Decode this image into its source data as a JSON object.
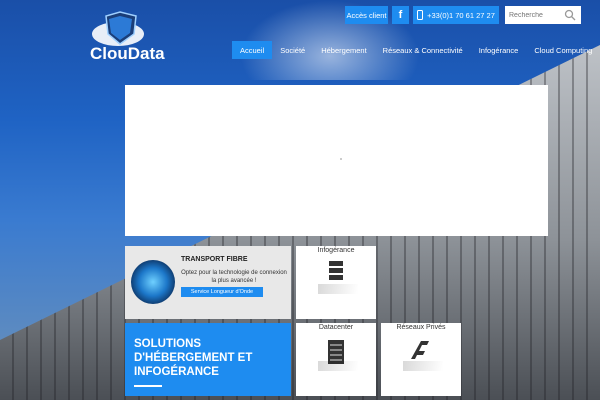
{
  "brand": {
    "name": "ClouData"
  },
  "topbar": {
    "client_label": "Accès client",
    "facebook_glyph": "f",
    "phone": "+33(0)1 70 61 27 27",
    "search_placeholder": "Recherche"
  },
  "nav": {
    "items": [
      "Accueil",
      "Société",
      "Hébergement",
      "Réseaux & Connectivité",
      "Infogérance",
      "Cloud Computing"
    ],
    "active": "Accueil"
  },
  "fibre": {
    "title": "TRANSPORT FIBRE",
    "text": "Optez pour la technologie de connexion la plus avancée !",
    "button": "Service Longueur d'Onde"
  },
  "tiles": {
    "infogerance": "Infogérance",
    "datacenter": "Datacenter",
    "reseaux": "Réseaux Privés"
  },
  "solutions": {
    "heading_line1": "SOLUTIONS",
    "heading_line2": "D'HÉBERGEMENT ET",
    "heading_line3": "INFOGÉRANCE"
  },
  "colors": {
    "accent": "#1e8cf0",
    "background": "#1f63c4"
  },
  "icons": [
    "shield-icon",
    "facebook-icon",
    "phone-icon",
    "search-icon",
    "server-icon",
    "network-icon"
  ]
}
